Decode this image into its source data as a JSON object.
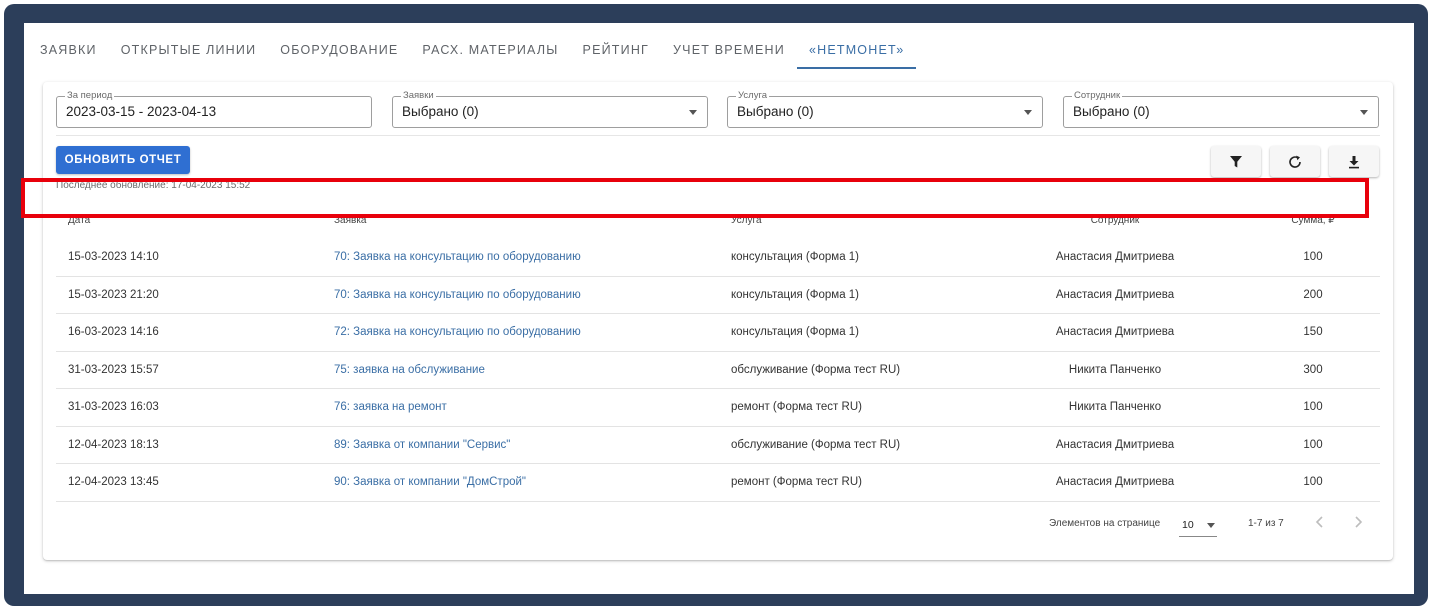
{
  "tabs": [
    {
      "label": "ЗАЯВКИ",
      "active": false
    },
    {
      "label": "ОТКРЫТЫЕ ЛИНИИ",
      "active": false
    },
    {
      "label": "ОБОРУДОВАНИЕ",
      "active": false
    },
    {
      "label": "РАСХ. МАТЕРИАЛЫ",
      "active": false
    },
    {
      "label": "РЕЙТИНГ",
      "active": false
    },
    {
      "label": "УЧЕТ ВРЕМЕНИ",
      "active": false
    },
    {
      "label": "«НЕТМОНЕТ»",
      "active": true
    }
  ],
  "filters": {
    "period": {
      "label": "За период",
      "value": "2023-03-15 - 2023-04-13"
    },
    "requests": {
      "label": "Заявки",
      "value": "Выбрано (0)"
    },
    "service": {
      "label": "Услуга",
      "value": "Выбрано (0)"
    },
    "employee": {
      "label": "Сотрудник",
      "value": "Выбрано (0)"
    }
  },
  "actions": {
    "refresh_label": "ОБНОВИТЬ ОТЧЕТ",
    "last_update": "Последнее обновление: 17-04-2023 15:52",
    "filter_icon": "filter-icon",
    "reload_icon": "refresh-icon",
    "download_icon": "download-icon"
  },
  "table": {
    "headers": {
      "date": "Дата",
      "request": "Заявка",
      "service": "Услуга",
      "employee": "Сотрудник",
      "sum": "Сумма, ₽"
    },
    "rows": [
      {
        "date": "15-03-2023 14:10",
        "request": "70: Заявка на консультацию по оборудованию",
        "service": "консультация (Форма 1)",
        "employee": "Анастасия Дмитриева",
        "sum": "100"
      },
      {
        "date": "15-03-2023 21:20",
        "request": "70: Заявка на консультацию по оборудованию",
        "service": "консультация (Форма 1)",
        "employee": "Анастасия Дмитриева",
        "sum": "200"
      },
      {
        "date": "16-03-2023 14:16",
        "request": "72: Заявка на консультацию по оборудованию",
        "service": "консультация (Форма 1)",
        "employee": "Анастасия Дмитриева",
        "sum": "150"
      },
      {
        "date": "31-03-2023 15:57",
        "request": "75: заявка на обслуживание",
        "service": "обслуживание (Форма тест RU)",
        "employee": "Никита Панченко",
        "sum": "300"
      },
      {
        "date": "31-03-2023 16:03",
        "request": "76: заявка на ремонт",
        "service": "ремонт (Форма тест RU)",
        "employee": "Никита Панченко",
        "sum": "100"
      },
      {
        "date": "12-04-2023 18:13",
        "request": "89: Заявка от компании \"Сервис\"",
        "service": "обслуживание (Форма тест RU)",
        "employee": "Анастасия Дмитриева",
        "sum": "100"
      },
      {
        "date": "12-04-2023 13:45",
        "request": "90: Заявка от компании \"ДомСтрой\"",
        "service": "ремонт (Форма тест RU)",
        "employee": "Анастасия Дмитриева",
        "sum": "100"
      }
    ]
  },
  "pagination": {
    "per_page_label": "Элементов на странице",
    "per_page_value": "10",
    "range": "1-7 из 7",
    "prev_icon": "chevron-left-icon",
    "next_icon": "chevron-right-icon"
  },
  "colors": {
    "frame": "#2c3e5a",
    "accent": "#3a6ea5",
    "button": "#2f6fd2",
    "highlight": "#e8000b"
  }
}
